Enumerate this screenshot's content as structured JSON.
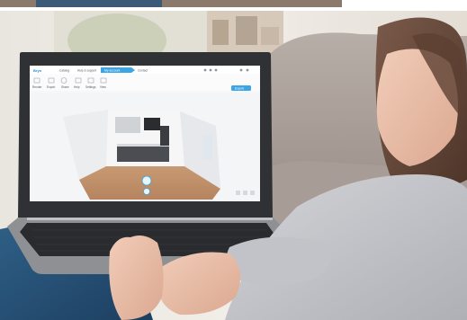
{
  "app": {
    "logo": "Bryn",
    "tabs": [
      "Catalog",
      "Help & support",
      "My account",
      "Contact"
    ],
    "active_tab": "My account",
    "toolbar": [
      "Render",
      "Export",
      "Share",
      "Help",
      "Settings",
      "View"
    ],
    "primary_button": "Export",
    "accent_color": "#3aa6e6"
  }
}
